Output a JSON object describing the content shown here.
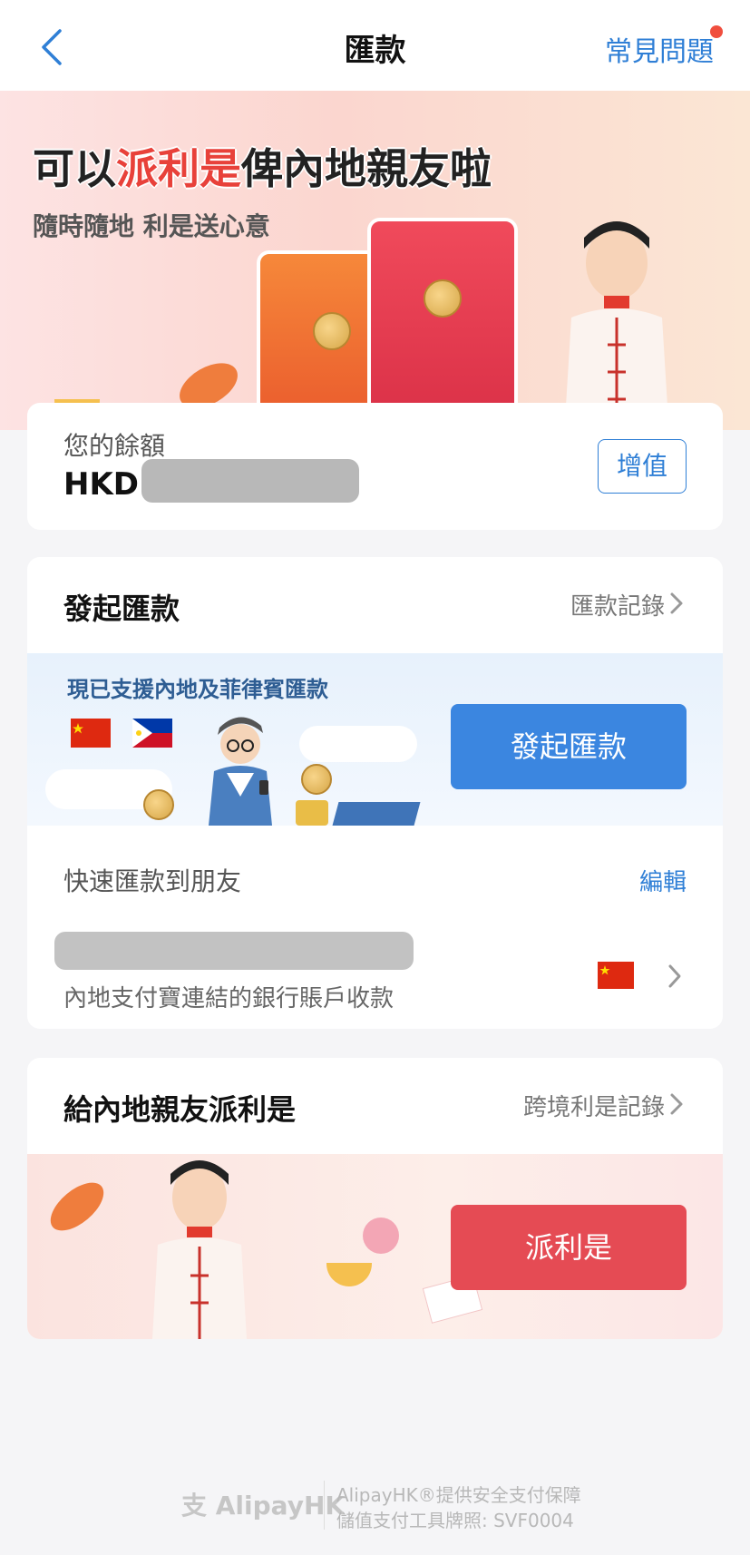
{
  "header": {
    "title": "匯款",
    "faq_label": "常見問題"
  },
  "banner": {
    "headline_pre": "可以",
    "headline_highlight": "派利是",
    "headline_post": "俾內地親友啦",
    "subtitle": "隨時隨地 利是送心意"
  },
  "balance": {
    "label": "您的餘額",
    "currency": "HKD",
    "topup_label": "增值"
  },
  "remittance": {
    "title": "發起匯款",
    "history_link": "匯款記錄",
    "promo_text": "現已支援內地及菲律賓匯款",
    "send_button": "發起匯款",
    "quick_label": "快速匯款到朋友",
    "edit_label": "編輯",
    "recipient_subtext": "內地支付寶連結的銀行賬戶收款"
  },
  "red_packet": {
    "title": "給內地親友派利是",
    "history_link": "跨境利是記錄",
    "button": "派利是"
  },
  "footer": {
    "logo_text": "支 AlipayHK",
    "line1": "AlipayHK®提供安全支付保障",
    "line2": "儲值支付工具牌照: SVF0004"
  },
  "colors": {
    "accent_blue": "#2f7fd6",
    "button_blue": "#3b86e0",
    "button_red": "#e54b54",
    "notify_dot": "#f04e3e"
  }
}
